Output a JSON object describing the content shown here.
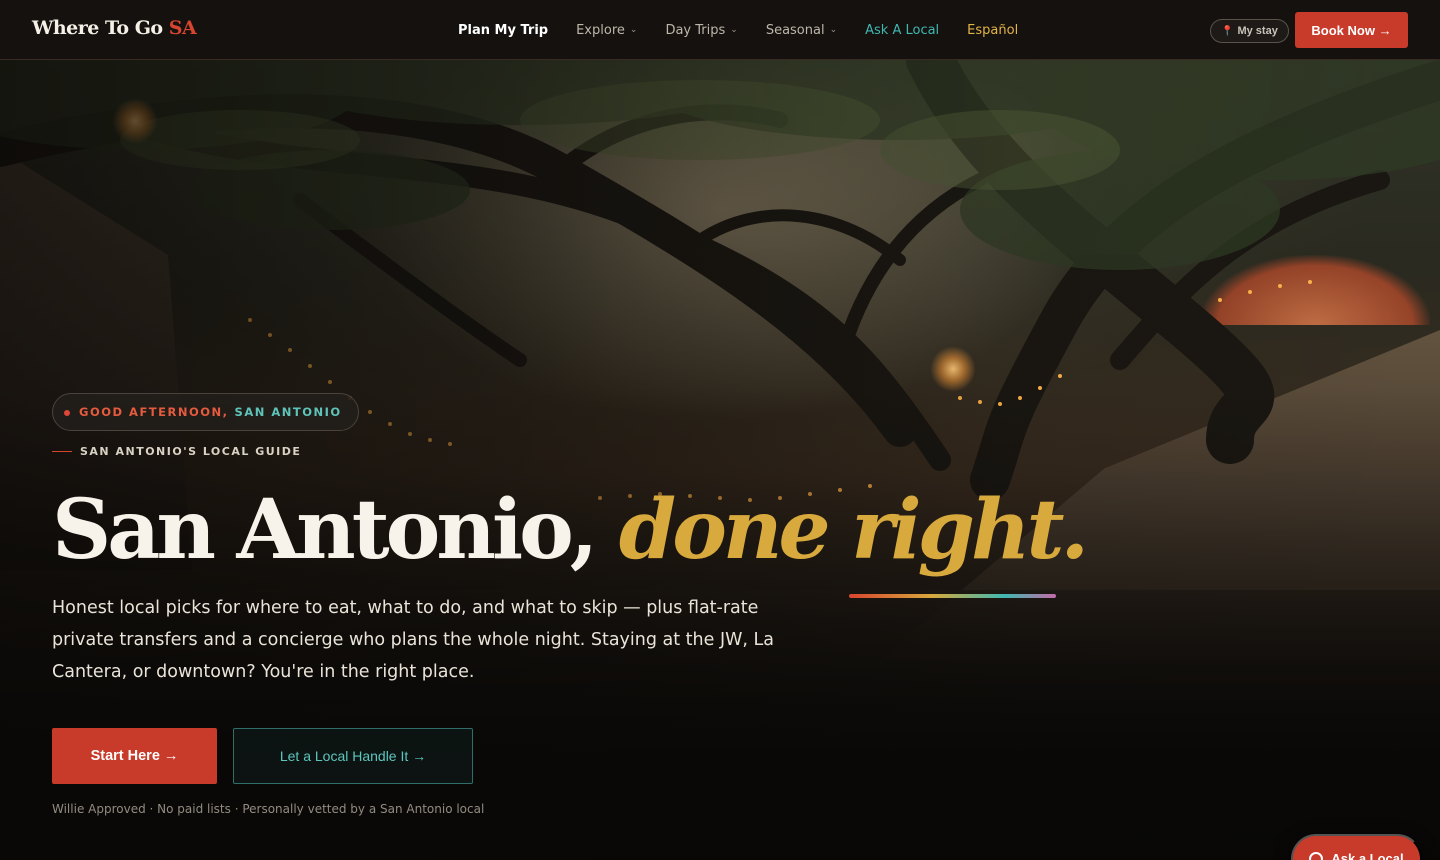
{
  "brand": {
    "name": "Where To Go",
    "accent": "SA",
    "accent_color": "#d8452f"
  },
  "nav": {
    "items": [
      {
        "label": "Plan My Trip",
        "caret": false
      },
      {
        "label": "Explore",
        "caret": true
      },
      {
        "label": "Day Trips",
        "caret": true
      },
      {
        "label": "Seasonal",
        "caret": true
      },
      {
        "label": "Ask A Local",
        "caret": false
      },
      {
        "label": "Español",
        "caret": false
      }
    ],
    "my_stay": "My stay",
    "book_now": "Book Now →"
  },
  "hero": {
    "greeting": "GOOD AFTERNOON,",
    "greeting_city": "SAN ANTONIO",
    "eyebrow": "SAN ANTONIO'S LOCAL GUIDE",
    "headline_main": "San Antonio, ",
    "headline_accent": "done right.",
    "subtext": "Honest local picks for where to eat, what to do, and what to skip — plus flat-rate private transfers and a concierge who plans the whole night. Staying at the JW, La Cantera, or downtown? You're in the right place.",
    "cta_primary": "Start Here →",
    "cta_secondary": "Let a Local Handle It →",
    "trust_line": "Willie Approved · No paid lists · Personally vetted by a San Antonio local"
  },
  "chat": {
    "label": "Ask a Local"
  },
  "colors": {
    "primary": "#c83a2a",
    "teal": "#3fb8b0",
    "gold": "#d8a93c",
    "nav_bg": "#14110f"
  }
}
